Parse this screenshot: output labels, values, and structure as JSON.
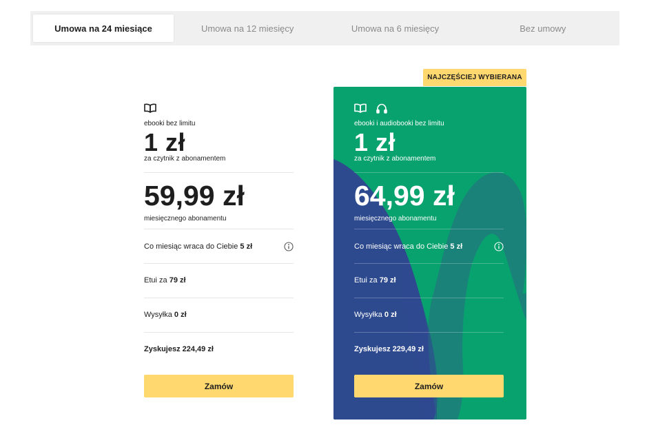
{
  "tabs": [
    {
      "label": "Umowa na 24 miesiące",
      "active": true
    },
    {
      "label": "Umowa na 12 miesięcy",
      "active": false
    },
    {
      "label": "Umowa na 6 miesięcy",
      "active": false
    },
    {
      "label": "Bez umowy",
      "active": false
    }
  ],
  "badge": "NAJCZĘŚCIEJ WYBIERANA",
  "plans": [
    {
      "icons": [
        "book-icon"
      ],
      "name": "ebooki bez limitu",
      "reader_price": "1 zł",
      "reader_caption": "za czytnik z abonamentem",
      "monthly_price": "59,99 zł",
      "monthly_caption": "miesięcznego abonamentu",
      "cashback_text": "Co miesiąc wraca do Ciebie",
      "cashback_value": "5 zł",
      "case_text": "Etui za",
      "case_value": "79 zł",
      "shipping_text": "Wysyłka",
      "shipping_value": "0 zł",
      "savings": "Zyskujesz 224,49 zł",
      "order_label": "Zamów"
    },
    {
      "icons": [
        "book-icon",
        "headphones-icon"
      ],
      "name": "ebooki i audiobooki bez limitu",
      "reader_price": "1 zł",
      "reader_caption": "za czytnik z abonamentem",
      "monthly_price": "64,99 zł",
      "monthly_caption": "miesięcznego abonamentu",
      "cashback_text": "Co miesiąc wraca do Ciebie",
      "cashback_value": "5 zł",
      "case_text": "Etui za",
      "case_value": "79 zł",
      "shipping_text": "Wysyłka",
      "shipping_value": "0 zł",
      "savings": "Zyskujesz 229,49 zł",
      "order_label": "Zamów"
    }
  ],
  "colors": {
    "accent_yellow": "#ffd86f",
    "featured_green": "#08a26e",
    "deco_blue": "#2e4a8f",
    "deco_teal": "#1f7d7d"
  }
}
